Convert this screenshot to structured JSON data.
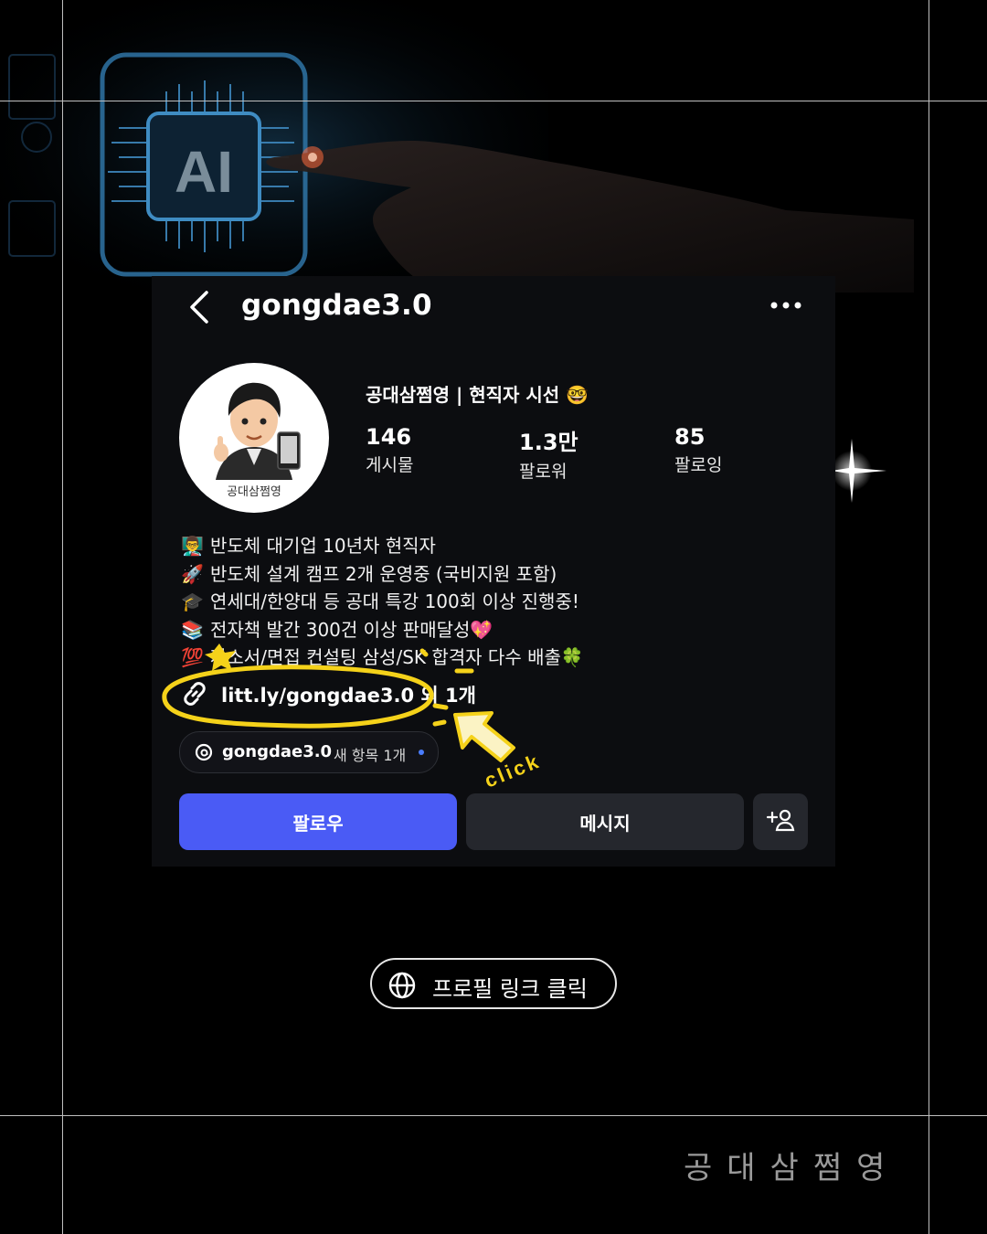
{
  "profile": {
    "username": "gongdae3.0",
    "display_name": "공대삼쩜영 | 현직자 시선 🤓",
    "avatar_caption": "공대삼쩜영",
    "stats": [
      {
        "value": "146",
        "label": "게시물"
      },
      {
        "value": "1.3만",
        "label": "팔로워"
      },
      {
        "value": "85",
        "label": "팔로잉"
      }
    ],
    "bio": [
      {
        "emoji": "👨‍🏫",
        "text": "반도체 대기업 10년차 현직자"
      },
      {
        "emoji": "🚀",
        "text": "반도체 설계 캠프 2개 운영중 (국비지원 포함)"
      },
      {
        "emoji": "🎓",
        "text": "연세대/한양대 등 공대 특강 100회 이상 진행중!"
      },
      {
        "emoji": "📚",
        "text": "전자책 발간 300건 이상 판매달성💖"
      },
      {
        "emoji": "💯",
        "text": "자소서/면접 컨설팅 삼성/SK 합격자 다수 배출🍀"
      }
    ],
    "link_text": "litt.ly/gongdae3.0 외 1개",
    "threads": {
      "name": "gongdae3.0",
      "new_items": "새 항목 1개"
    },
    "buttons": {
      "follow": "팔로우",
      "message": "메시지"
    }
  },
  "annotation": {
    "click_label": "click"
  },
  "cta": {
    "label": "프로필 링크 클릭"
  },
  "watermark": "공대삼쩜영",
  "background": {
    "chip_label": "AI"
  },
  "colors": {
    "accent_blue": "#4a5bf5",
    "annotation_yellow": "#f5d21a",
    "card_bg": "#0c0d10"
  }
}
